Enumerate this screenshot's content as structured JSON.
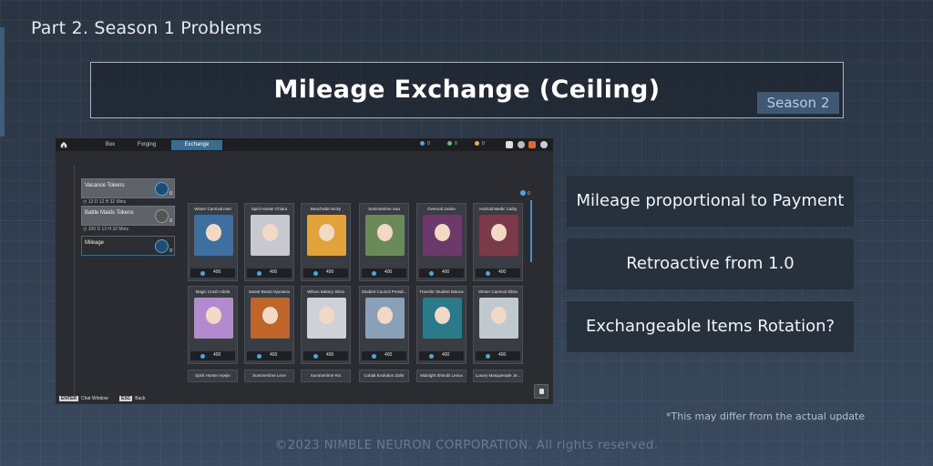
{
  "header": {
    "part_title": "Part 2. Season 1 Problems",
    "main_title": "Mileage Exchange (Ceiling)",
    "season_badge": "Season 2"
  },
  "game": {
    "tabs": [
      "Box",
      "Forging",
      "Exchange"
    ],
    "active_tab": "Exchange",
    "currencies": [
      "0",
      "0",
      "0"
    ],
    "sidebar": [
      {
        "label": "Vacance Tokens",
        "count": "0",
        "sub": "13 D 12 H 32 Mins",
        "icon": "mileage-token-icon"
      },
      {
        "label": "Battle Maids Tokens",
        "count": "0",
        "sub": "100 D 12 H 32 Mins",
        "icon": "maid-token-icon"
      },
      {
        "label": "Mileage",
        "count": "0",
        "sub": "",
        "icon": "mileage-icon"
      }
    ],
    "mileage_balance": "0",
    "cards_row1": [
      {
        "name": "Winter Carnival Hart",
        "price": "400",
        "color": "#3d6fa0"
      },
      {
        "name": "Spirit Hunter Chiara",
        "price": "400",
        "color": "#c8c8d0"
      },
      {
        "name": "Beachside Nicky",
        "price": "400",
        "color": "#e2a43a"
      },
      {
        "name": "Summertime Sua",
        "price": "400",
        "color": "#6a8a5a"
      },
      {
        "name": "Overvolt Jackie",
        "price": "400",
        "color": "#6b3a6a"
      },
      {
        "name": "Android Medic Cathy",
        "price": "400",
        "color": "#7a3a4a"
      }
    ],
    "cards_row2": [
      {
        "name": "Magic Crush Adela",
        "price": "400",
        "color": "#b38ad0"
      },
      {
        "name": "Sweet Beast Hyunwoo",
        "price": "400",
        "color": "#c0642a"
      },
      {
        "name": "Wilson Bakery Silvia",
        "price": "400",
        "color": "#d0d0d8"
      },
      {
        "name": "Student Council Presid...",
        "price": "400",
        "color": "#8aa0b8"
      },
      {
        "name": "Transfer Student Bianca",
        "price": "400",
        "color": "#2a7a8a"
      },
      {
        "name": "Winter Carnival Silvia",
        "price": "400",
        "color": "#c0c8d0"
      }
    ],
    "cards_row3": [
      {
        "name": "Spirit Hunter Hyejin"
      },
      {
        "name": "Summertime Leon"
      },
      {
        "name": "Summertime Rio"
      },
      {
        "name": "Cobalt Evolution Zahir"
      },
      {
        "name": "Midnight Shinobi Lenox"
      },
      {
        "name": "Luxury Masquerade Je..."
      }
    ],
    "hint_enter_key": "ENTER",
    "hint_enter_label": "Chat Window",
    "hint_esc_key": "ESC",
    "hint_esc_label": "Back"
  },
  "features": [
    "Mileage proportional to Payment",
    "Retroactive from 1.0",
    "Exchangeable Items Rotation?"
  ],
  "disclaimer": "*This may differ from the actual update",
  "copyright": "©2023 NIMBLE NEURON CORPORATION. All rights reserved."
}
